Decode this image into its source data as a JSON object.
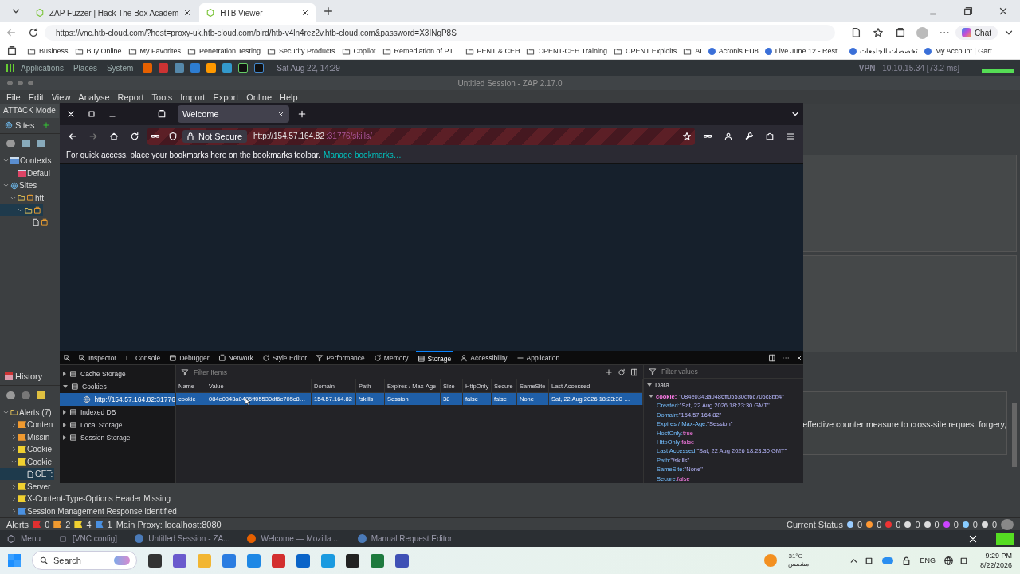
{
  "edge": {
    "tabs": [
      {
        "label": "ZAP Fuzzer | Hack The Box Academ",
        "selected": false
      },
      {
        "label": "HTB Viewer",
        "selected": true
      }
    ],
    "url": "https://vnc.htb-cloud.com/?host=proxy-uk.htb-cloud.com/bird/htb-v4ln4rez2v.htb-cloud.com&password=X3INgP8S",
    "chat": "Chat",
    "bookmarks": [
      {
        "label": "Business",
        "kind": "folder"
      },
      {
        "label": "Buy Online",
        "kind": "folder"
      },
      {
        "label": "My Favorites",
        "kind": "folder"
      },
      {
        "label": "Penetration Testing",
        "kind": "folder"
      },
      {
        "label": "Security Products",
        "kind": "folder"
      },
      {
        "label": "Copilot",
        "kind": "folder"
      },
      {
        "label": "Remediation of PT...",
        "kind": "folder"
      },
      {
        "label": "PENT & CEH",
        "kind": "folder"
      },
      {
        "label": "CPENT-CEH Training",
        "kind": "folder"
      },
      {
        "label": "CPENT Exploits",
        "kind": "folder"
      },
      {
        "label": "AI",
        "kind": "folder"
      },
      {
        "label": "Acronis EU8",
        "kind": "site"
      },
      {
        "label": "Live June 12 - Rest...",
        "kind": "site"
      },
      {
        "label": "تخصصات الجامعات",
        "kind": "site"
      },
      {
        "label": "My Account | Gart...",
        "kind": "site"
      }
    ]
  },
  "panel": {
    "menus": [
      "Applications",
      "Places",
      "System"
    ],
    "clock": "Sat Aug 22, 14:29",
    "vpn": "**VPN** - 10.10.15.34 [73.2 ms]"
  },
  "zap": {
    "title": "Untitled Session - ZAP 2.17.0",
    "menu": [
      "File",
      "Edit",
      "View",
      "Analyse",
      "Report",
      "Tools",
      "Import",
      "Export",
      "Online",
      "Help"
    ],
    "mode": "ATTACK Mode",
    "sites_tab": "Sites",
    "sites_tree": [
      {
        "label": "Contexts",
        "kind": "contexts",
        "expanded": true,
        "selected": false,
        "children": [
          {
            "label": "Defaul",
            "kind": "context",
            "selected": false
          }
        ]
      },
      {
        "label": "Sites",
        "kind": "sites",
        "expanded": true,
        "selected": false,
        "children": [
          {
            "label": "htt",
            "kind": "site",
            "expanded": true,
            "selected": false,
            "children": [
              {
                "kind": "site",
                "expanded": true,
                "selected": true,
                "children": [
                  {
                    "kind": "page",
                    "selected": false
                  }
                ]
              }
            ]
          }
        ]
      }
    ],
    "history_tab": "History",
    "alerts_tree": [
      {
        "label": "Alerts (7)",
        "kind": "folder",
        "expanded": true,
        "selected": false,
        "children": [
          {
            "label": "Conten",
            "kind": "alert",
            "color": "#f09a30",
            "expanded": false,
            "selected": false
          },
          {
            "label": "Missin",
            "kind": "alert",
            "color": "#f09a30",
            "expanded": false,
            "selected": false
          },
          {
            "label": "Cookie",
            "kind": "alert",
            "color": "#f0d030",
            "expanded": false,
            "selected": false
          },
          {
            "label": "Cookie",
            "kind": "alert",
            "color": "#f0d030",
            "expanded": true,
            "selected": false,
            "children": [
              {
                "label": "GET:",
                "kind": "request",
                "selected": true
              }
            ]
          },
          {
            "label": "Server",
            "kind": "alert",
            "color": "#f0d030",
            "expanded": false,
            "selected": false
          },
          {
            "label": "X-Content-Type-Options Header Missing",
            "kind": "alert",
            "color": "#f0d030",
            "expanded": false,
            "selected": false
          },
          {
            "label": "Session Management Response Identified",
            "kind": "alert",
            "color": "#4a90e0",
            "expanded": false,
            "selected": false
          }
        ]
      }
    ],
    "description": "effective counter measure to cross-site request forgery,",
    "status": {
      "label": "Alerts",
      "flags": [
        {
          "count": "0",
          "color": "#e03030"
        },
        {
          "count": "2",
          "color": "#f09a30"
        },
        {
          "count": "4",
          "color": "#f0d030"
        },
        {
          "count": "1",
          "color": "#4a90e0"
        }
      ],
      "proxy": "Main Proxy: localhost:8080",
      "current": "Current Status",
      "counts": [
        "0",
        "0",
        "0",
        "0",
        "0",
        "0",
        "0",
        "0"
      ]
    }
  },
  "firefox": {
    "tab": "Welcome",
    "not_secure": "Not Secure",
    "url_host": "http://154.57.164.82",
    "url_rest": ":31776/skills/",
    "bookmarks_hint": "For quick access, place your bookmarks here on the bookmarks toolbar.",
    "bookmarks_link": "Manage bookmarks…",
    "devtools": {
      "tabs": [
        {
          "label": "Inspector",
          "selected": false
        },
        {
          "label": "Console",
          "selected": false
        },
        {
          "label": "Debugger",
          "selected": false
        },
        {
          "label": "Network",
          "selected": false
        },
        {
          "label": "Style Editor",
          "selected": false
        },
        {
          "label": "Performance",
          "selected": false
        },
        {
          "label": "Memory",
          "selected": false
        },
        {
          "label": "Storage",
          "selected": true
        },
        {
          "label": "Accessibility",
          "selected": false
        },
        {
          "label": "Application",
          "selected": false
        }
      ],
      "tree": [
        {
          "label": "Cache Storage",
          "kind": "store",
          "expanded": false,
          "selected": false
        },
        {
          "label": "Cookies",
          "kind": "store",
          "expanded": true,
          "selected": false,
          "children": [
            {
              "label": "http://154.57.164.82:31776",
              "kind": "origin",
              "selected": true
            }
          ]
        },
        {
          "label": "Indexed DB",
          "kind": "store",
          "expanded": false,
          "selected": false
        },
        {
          "label": "Local Storage",
          "kind": "store",
          "expanded": false,
          "selected": false
        },
        {
          "label": "Session Storage",
          "kind": "store",
          "expanded": false,
          "selected": false
        }
      ],
      "filter_placeholder": "Filter Items",
      "columns": [
        "Name",
        "Value",
        "Domain",
        "Path",
        "Expires / Max-Age",
        "Size",
        "HttpOnly",
        "Secure",
        "SameSite",
        "Last Accessed"
      ],
      "rows": [
        {
          "selected": true,
          "cells": [
            "cookie",
            "084e0343a0486ff05530df6c705c8…",
            "154.57.164.82",
            "/skills",
            "Session",
            "38",
            "false",
            "false",
            "None",
            "Sat, 22 Aug 2026 18:23:30 …"
          ]
        }
      ],
      "values_placeholder": "Filter values",
      "data_heading": "Data",
      "cookie_key": "cookie:",
      "cookie_value": "\"084e0343a0486ff05530df6c705c8bb4\"",
      "fields": [
        {
          "key": "Created:",
          "value": "\"Sat, 22 Aug 2026 18:23:30 GMT\"",
          "kind": "string"
        },
        {
          "key": "Domain:",
          "value": "\"154.57.164.82\"",
          "kind": "string"
        },
        {
          "key": "Expires / Max-Age:",
          "value": "\"Session\"",
          "kind": "string"
        },
        {
          "key": "HostOnly:",
          "value": "true",
          "kind": "bool"
        },
        {
          "key": "HttpOnly:",
          "value": "false",
          "kind": "bool"
        },
        {
          "key": "Last Accessed:",
          "value": "\"Sat, 22 Aug 2026 18:23:30 GMT\"",
          "kind": "string"
        },
        {
          "key": "Path:",
          "value": "\"/skills\"",
          "kind": "string"
        },
        {
          "key": "SameSite:",
          "value": "\"None\"",
          "kind": "string"
        },
        {
          "key": "Secure:",
          "value": "false",
          "kind": "bool"
        }
      ]
    }
  },
  "vnc_taskbar": [
    {
      "label": "Menu",
      "kind": "menu"
    },
    {
      "label": "[VNC config]",
      "kind": "window"
    },
    {
      "label": "Untitled Session - ZA...",
      "kind": "zap"
    },
    {
      "label": "Welcome — Mozilla ...",
      "kind": "firefox"
    },
    {
      "label": "Manual Request Editor",
      "kind": "zap"
    }
  ],
  "win_taskbar": {
    "search": "Search",
    "temp": "31°C",
    "weather": "مشمس",
    "lang": "ENG",
    "time": "9:29 PM",
    "date": "8/22/2026"
  }
}
